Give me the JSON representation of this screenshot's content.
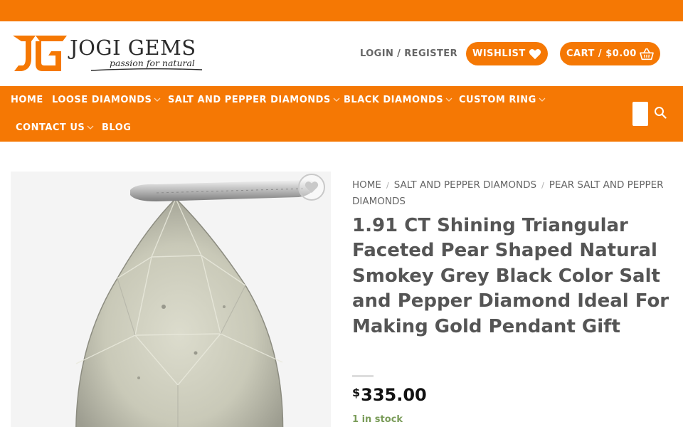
{
  "brand": {
    "name": "JOGI GEMS",
    "tagline": "passion for natural",
    "color": "#f57804"
  },
  "header": {
    "login_label": "LOGIN / REGISTER",
    "wishlist_label": "WISHLIST",
    "wishlist_icon": "heart-icon",
    "cart_label": "CART / $0.00",
    "cart_icon": "basket-icon"
  },
  "nav": {
    "items": [
      {
        "label": "HOME",
        "has_dropdown": false
      },
      {
        "label": "LOOSE DIAMONDS",
        "has_dropdown": true
      },
      {
        "label": "SALT AND PEPPER DIAMONDS",
        "has_dropdown": true
      },
      {
        "label": "BLACK DIAMONDS",
        "has_dropdown": true
      },
      {
        "label": "CUSTOM RING",
        "has_dropdown": true
      },
      {
        "label": "CONTACT US",
        "has_dropdown": true
      },
      {
        "label": "BLOG",
        "has_dropdown": false
      }
    ],
    "search_icon": "search-icon"
  },
  "breadcrumb": {
    "items": [
      "HOME",
      "SALT AND PEPPER DIAMONDS",
      "PEAR SALT AND PEPPER DIAMONDS"
    ],
    "separator": "/"
  },
  "product": {
    "title": "1.91 CT Shining Triangular Faceted Pear Shaped Natural Smokey Grey Black Color Salt and Pepper Diamond Ideal For Making Gold Pendant Gift",
    "currency_symbol": "$",
    "price": "335.00",
    "stock": "1 in stock",
    "stock_color": "#7a9c59"
  }
}
